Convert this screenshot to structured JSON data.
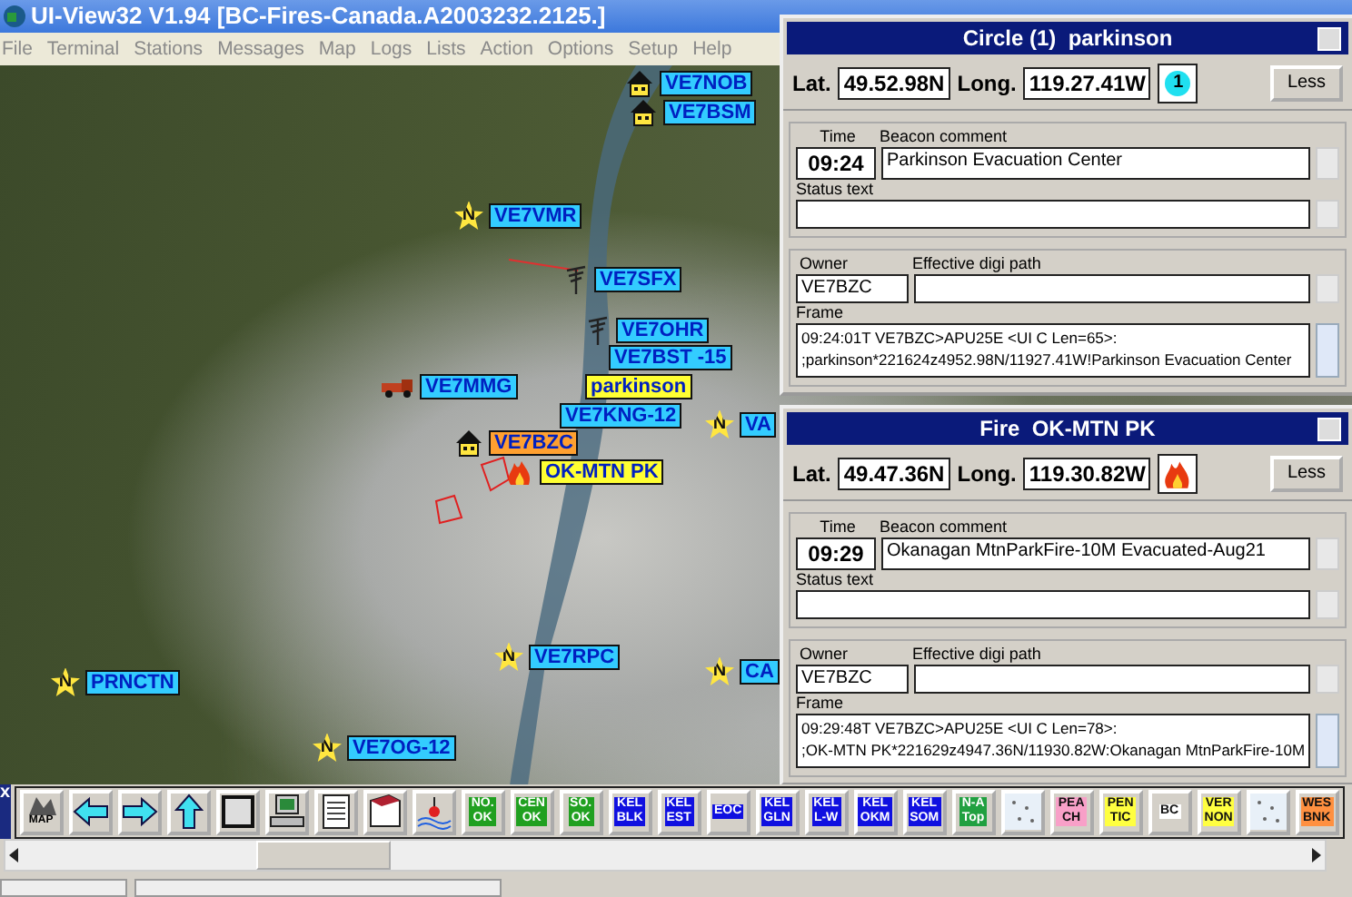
{
  "window": {
    "title": "UI-View32 V1.94 [BC-Fires-Canada.A2003232.2125.]"
  },
  "menu": [
    "File",
    "Terminal",
    "Stations",
    "Messages",
    "Map",
    "Logs",
    "Lists",
    "Action",
    "Options",
    "Setup",
    "Help"
  ],
  "map": {
    "stations": [
      {
        "label": "VE7NOB",
        "kind": "house",
        "color": "#33ccff"
      },
      {
        "label": "VE7BSM",
        "kind": "house",
        "color": "#33ccff"
      },
      {
        "label": "VE7VMR",
        "kind": "star",
        "symbol_text": "N",
        "color": "#33ccff"
      },
      {
        "label": "VE7SFX",
        "kind": "antenna",
        "color": "#33ccff"
      },
      {
        "label": "VE7OHR",
        "kind": "antenna",
        "color": "#33ccff"
      },
      {
        "label": "VE7BST -15",
        "kind": "plain",
        "color": "#33ccff"
      },
      {
        "label": "VE7MMG",
        "kind": "truck",
        "color": "#33ccff"
      },
      {
        "label": "parkinson",
        "kind": "plain",
        "color": "#ffff33"
      },
      {
        "label": "VE7KNG-12",
        "kind": "plain",
        "color": "#33ccff"
      },
      {
        "label": "VE7BZC",
        "kind": "house",
        "color": "#ffa030"
      },
      {
        "label": "VA",
        "kind": "star",
        "symbol_text": "N",
        "color": "#33ccff"
      },
      {
        "label": "OK-MTN PK",
        "kind": "fire",
        "color": "#ffff33"
      },
      {
        "label": "PRNCTN",
        "kind": "star",
        "symbol_text": "N",
        "color": "#33ccff"
      },
      {
        "label": "VE7RPC",
        "kind": "star",
        "symbol_text": "N",
        "color": "#33ccff"
      },
      {
        "label": "CA",
        "kind": "star",
        "symbol_text": "N",
        "color": "#33ccff"
      },
      {
        "label": "VE7OG-12",
        "kind": "star",
        "symbol_text": "N",
        "color": "#33ccff"
      }
    ]
  },
  "panels": [
    {
      "title": "Circle (1)  parkinson",
      "lat_label": "Lat.",
      "lat": "49.52.98N",
      "long_label": "Long.",
      "long": "119.27.41W",
      "kind": "circle",
      "symbol_text": "1",
      "less_button": "Less",
      "time_label": "Time",
      "time": "09:24",
      "beacon_comment_label": "Beacon comment",
      "beacon_comment": "Parkinson Evacuation Center",
      "status_text_label": "Status text",
      "owner_label": "Owner",
      "owner": "VE7BZC",
      "digi_path_label": "Effective digi path",
      "frame_label": "Frame",
      "frame": [
        "09:24:01T VE7BZC>APU25E <UI C Len=65>:",
        ";parkinson*221624z4952.98N/11927.41W!Parkinson Evacuation Center"
      ]
    },
    {
      "title": "Fire  OK-MTN PK",
      "lat_label": "Lat.",
      "lat": "49.47.36N",
      "long_label": "Long.",
      "long": "119.30.82W",
      "kind": "fire",
      "less_button": "Less",
      "time_label": "Time",
      "time": "09:29",
      "beacon_comment_label": "Beacon comment",
      "beacon_comment": "Okanagan MtnParkFire-10M Evacuated-Aug21",
      "status_text_label": "Status text",
      "owner_label": "Owner",
      "owner": "VE7BZC",
      "digi_path_label": "Effective digi path",
      "frame_label": "Frame",
      "frame": [
        "09:29:48T VE7BZC>APU25E <UI C Len=78>:",
        ";OK-MTN PK*221629z4947.36N/11930.82W:Okanagan MtnParkFire-10M"
      ]
    }
  ],
  "toolbar": {
    "close": "x",
    "buttons": [
      {
        "kind": "map",
        "label": "MAP"
      },
      {
        "kind": "left"
      },
      {
        "kind": "right"
      },
      {
        "kind": "up"
      },
      {
        "kind": "frame"
      },
      {
        "kind": "computer"
      },
      {
        "kind": "list"
      },
      {
        "kind": "book"
      },
      {
        "kind": "buoy"
      },
      {
        "kind": "text",
        "label": "NO.\nOK",
        "color": "#20a020"
      },
      {
        "kind": "text",
        "label": "CEN\nOK",
        "color": "#20a020"
      },
      {
        "kind": "text",
        "label": "SO.\nOK",
        "color": "#20a020"
      },
      {
        "kind": "text",
        "label": "KEL\nBLK",
        "color": "#1010e0"
      },
      {
        "kind": "text",
        "label": "KEL\nEST",
        "color": "#1010e0"
      },
      {
        "kind": "text",
        "label": "EOC",
        "color": "#1010e0"
      },
      {
        "kind": "text",
        "label": "KEL\nGLN",
        "color": "#1010e0"
      },
      {
        "kind": "text",
        "label": "KEL\nL-W",
        "color": "#1010e0"
      },
      {
        "kind": "text",
        "label": "KEL\nOKM",
        "color": "#1010e0"
      },
      {
        "kind": "text",
        "label": "KEL\nSOM",
        "color": "#1010e0"
      },
      {
        "kind": "text",
        "label": "N-A\nTop",
        "color": "#20a040"
      },
      {
        "kind": "dots"
      },
      {
        "kind": "text",
        "label": "PEA\nCH",
        "color": "#f8a0c8"
      },
      {
        "kind": "text",
        "label": "PEN\nTIC",
        "color": "#ffff40"
      },
      {
        "kind": "text",
        "label": "BC",
        "color": "#ffffff"
      },
      {
        "kind": "text",
        "label": "VER\nNON",
        "color": "#ffff40"
      },
      {
        "kind": "dots"
      },
      {
        "kind": "text",
        "label": "WES\nBNK",
        "color": "#ff9040"
      }
    ]
  }
}
